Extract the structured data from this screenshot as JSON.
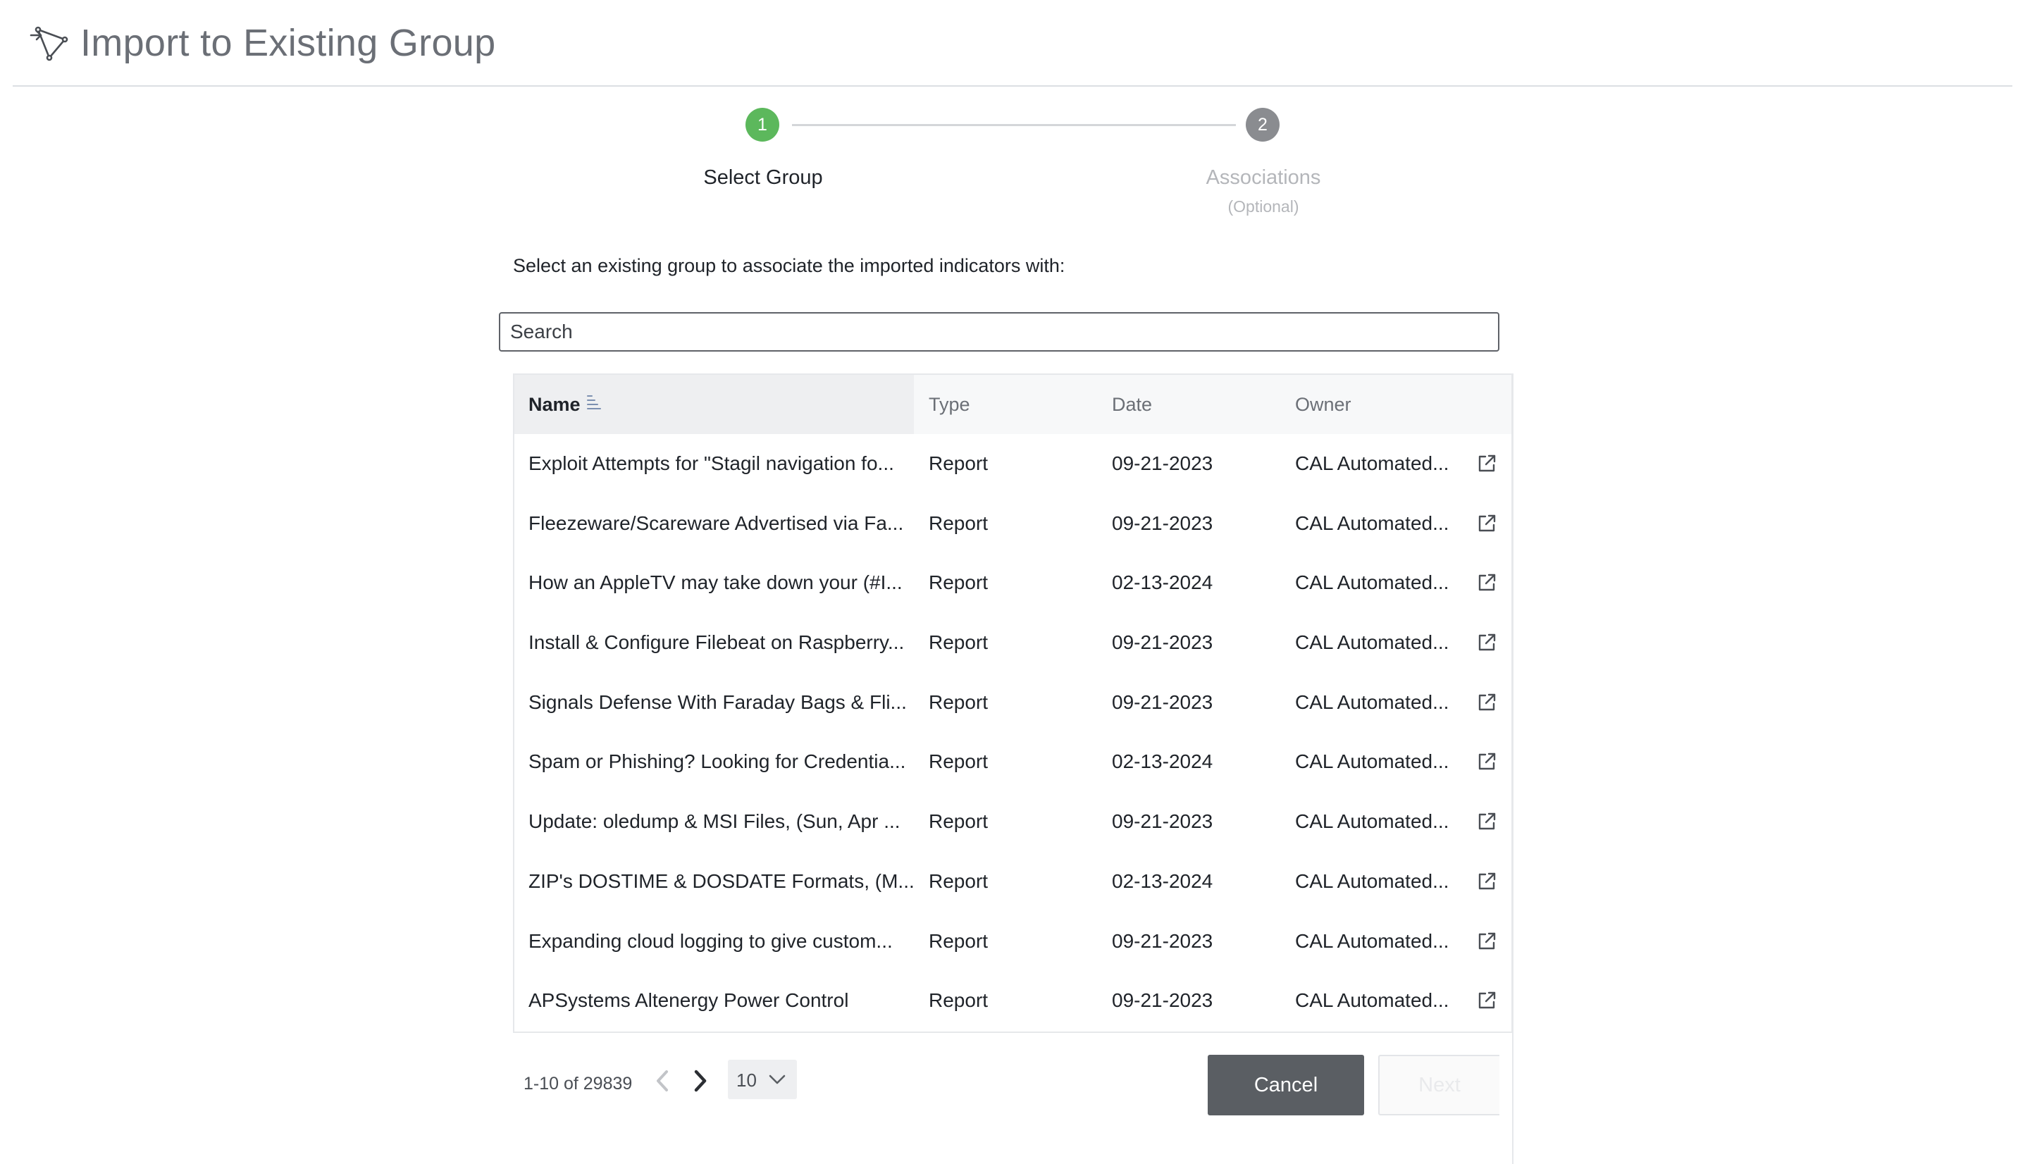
{
  "header": {
    "title": "Import to Existing Group",
    "icon": "import-group-icon"
  },
  "stepper": {
    "steps": [
      {
        "number": "1",
        "label": "Select Group",
        "sublabel": "",
        "state": "active",
        "color": "#5cb85c"
      },
      {
        "number": "2",
        "label": "Associations",
        "sublabel": "(Optional)",
        "state": "inactive",
        "color": "#8a8c90"
      }
    ]
  },
  "instructions": "Select an existing group to associate the imported indicators with:",
  "search": {
    "placeholder": "Search",
    "value": ""
  },
  "table": {
    "columns": {
      "name": "Name",
      "type": "Type",
      "date": "Date",
      "owner": "Owner"
    },
    "sorted_by": "Name",
    "rows": [
      {
        "name": "Exploit Attempts for \"Stagil navigation fo...",
        "type": "Report",
        "date": "09-21-2023",
        "owner": "CAL Automated..."
      },
      {
        "name": "Fleezeware/Scareware Advertised via Fa...",
        "type": "Report",
        "date": "09-21-2023",
        "owner": "CAL Automated..."
      },
      {
        "name": "How an AppleTV may take down your (#I...",
        "type": "Report",
        "date": "02-13-2024",
        "owner": "CAL Automated..."
      },
      {
        "name": "Install & Configure Filebeat on Raspberry...",
        "type": "Report",
        "date": "09-21-2023",
        "owner": "CAL Automated..."
      },
      {
        "name": "Signals Defense With Faraday Bags & Fli...",
        "type": "Report",
        "date": "09-21-2023",
        "owner": "CAL Automated..."
      },
      {
        "name": "Spam or Phishing? Looking for Credentia...",
        "type": "Report",
        "date": "02-13-2024",
        "owner": "CAL Automated..."
      },
      {
        "name": "Update: oledump & MSI Files, (Sun, Apr ...",
        "type": "Report",
        "date": "09-21-2023",
        "owner": "CAL Automated..."
      },
      {
        "name": "ZIP's DOSTIME & DOSDATE Formats, (M...",
        "type": "Report",
        "date": "02-13-2024",
        "owner": "CAL Automated..."
      },
      {
        "name": "Expanding cloud logging to give custom...",
        "type": "Report",
        "date": "09-21-2023",
        "owner": "CAL Automated..."
      },
      {
        "name": "APSystems Altenergy Power Control",
        "type": "Report",
        "date": "09-21-2023",
        "owner": "CAL Automated..."
      }
    ]
  },
  "pagination": {
    "range_text": "1-10 of 29839",
    "page_size": "10"
  },
  "buttons": {
    "cancel": "Cancel",
    "next": "Next"
  },
  "colors": {
    "active_step": "#5cb85c",
    "inactive_step": "#8a8c90",
    "cancel_bg": "#5a5e63"
  }
}
